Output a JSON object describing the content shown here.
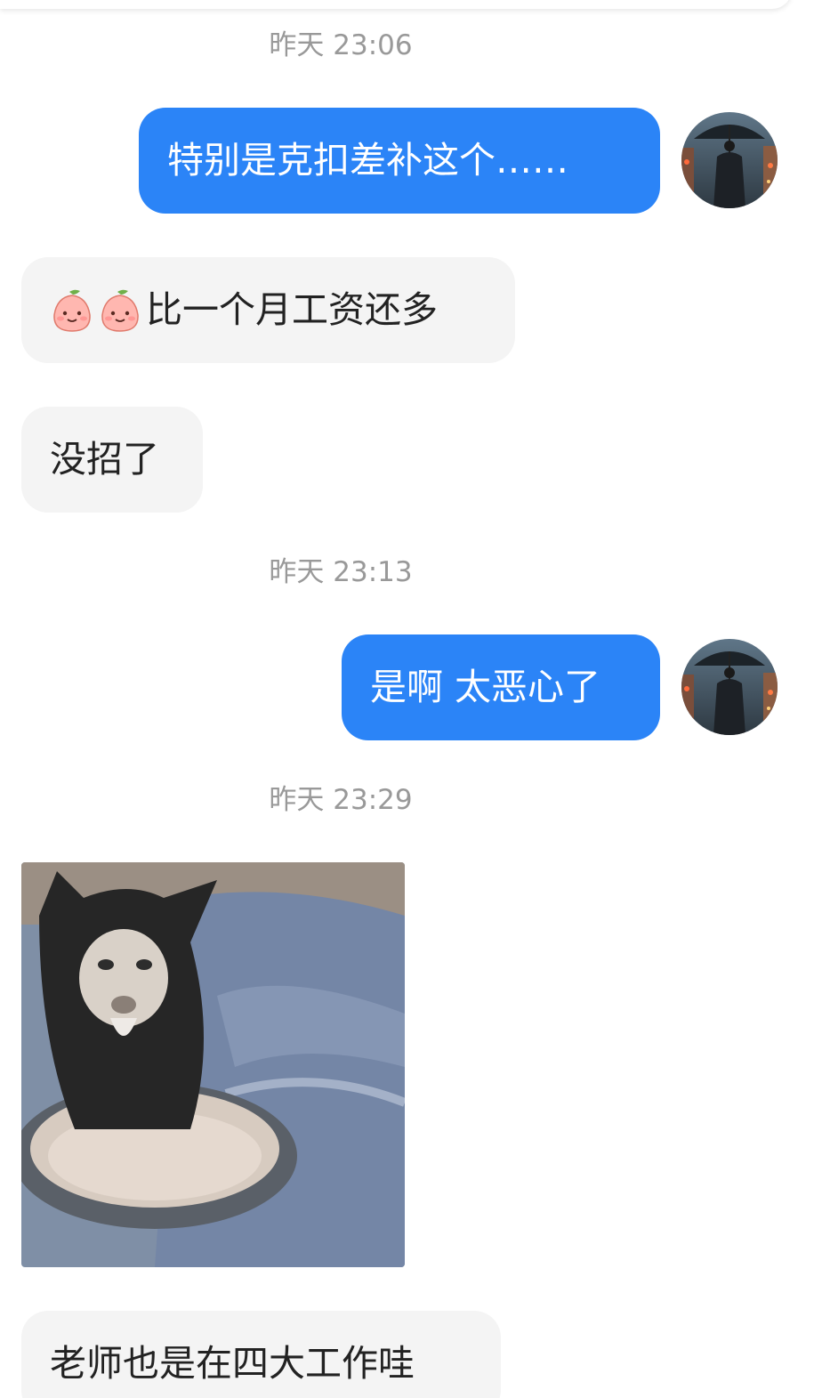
{
  "timestamps": {
    "t1": "昨天 23:06",
    "t2": "昨天 23:13",
    "t3": "昨天 23:29"
  },
  "messages": {
    "m1": "特别是克扣差补这个……",
    "m2": "比一个月工资还多",
    "m3": "没招了",
    "m4": "是啊 太恶心了",
    "m5": "老师也是在四大工作哇"
  },
  "emojis": [
    "peach-face-emoji",
    "peach-face-emoji"
  ],
  "colors": {
    "outgoing_bubble": "#2b84f7",
    "incoming_bubble": "#f4f4f4",
    "timestamp_text": "#999999"
  }
}
